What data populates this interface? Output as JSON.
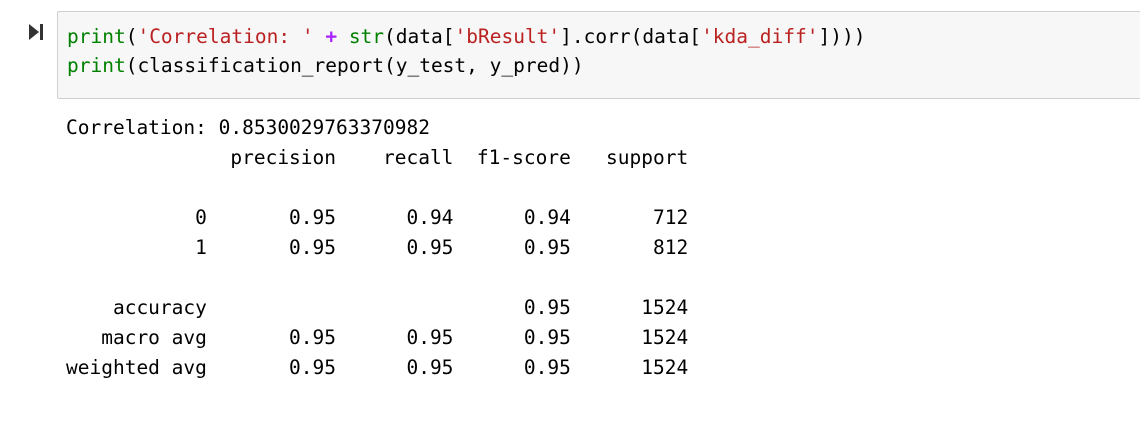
{
  "cell": {
    "run_icon": "run-cell-icon",
    "code_lines": [
      [
        {
          "t": "builtin",
          "v": "print"
        },
        {
          "t": "plain",
          "v": "("
        },
        {
          "t": "string",
          "v": "'Correlation: '"
        },
        {
          "t": "plain",
          "v": " "
        },
        {
          "t": "op",
          "v": "+"
        },
        {
          "t": "plain",
          "v": " "
        },
        {
          "t": "builtin",
          "v": "str"
        },
        {
          "t": "plain",
          "v": "(data["
        },
        {
          "t": "string",
          "v": "'bResult'"
        },
        {
          "t": "plain",
          "v": "].corr(data["
        },
        {
          "t": "string",
          "v": "'kda_diff'"
        },
        {
          "t": "plain",
          "v": "])))"
        }
      ],
      [
        {
          "t": "builtin",
          "v": "print"
        },
        {
          "t": "plain",
          "v": "(classification_report(y_test, y_pred))"
        }
      ]
    ]
  },
  "output": {
    "lines": [
      "Correlation: 0.8530029763370982",
      "              precision    recall  f1-score   support",
      "",
      "           0       0.95      0.94      0.94       712",
      "           1       0.95      0.95      0.95       812",
      "",
      "    accuracy                           0.95      1524",
      "   macro avg       0.95      0.95      0.95      1524",
      "weighted avg       0.95      0.95      0.95      1524"
    ]
  },
  "colors": {
    "builtin": "#008000",
    "string": "#ba2121",
    "operator": "#aa22ff",
    "cell_background": "#f7f7f7",
    "cell_border": "#cfcfcf"
  }
}
